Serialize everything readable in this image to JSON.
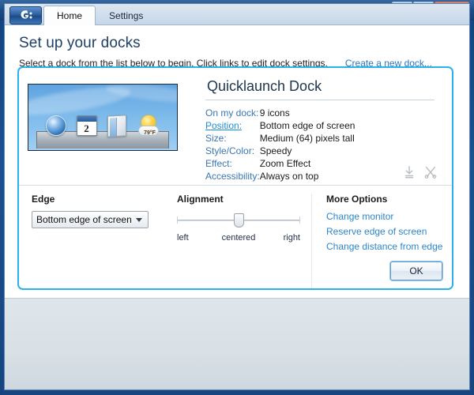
{
  "window": {
    "controls": {
      "minimize": "minimize-button",
      "maximize": "maximize-button",
      "close": "✕"
    }
  },
  "tabs": [
    {
      "label": "Home",
      "active": true
    },
    {
      "label": "Settings",
      "active": false
    }
  ],
  "header": {
    "title": "Set up your docks",
    "subtitle": "Select a dock from the list below to begin. Click links to edit dock settings.",
    "create_link": "Create a new dock..."
  },
  "dock": {
    "name": "Quicklaunch Dock",
    "preview": {
      "icons": [
        "windows-orb",
        "calendar",
        "document",
        "weather"
      ],
      "calendar_day": "2",
      "weather_temp": "79°F"
    },
    "specs": [
      {
        "label": "On my dock:",
        "value": "9 icons",
        "is_link": false
      },
      {
        "label": "Position:",
        "value": "Bottom edge of screen",
        "is_link": true
      },
      {
        "label": "Size:",
        "value": "Medium (64) pixels tall",
        "is_link": false
      },
      {
        "label": "Style/Color:",
        "value": "Speedy",
        "is_link": false
      },
      {
        "label": "Effect:",
        "value": "Zoom Effect",
        "is_link": false
      },
      {
        "label": "Accessibility:",
        "value": "Always on top",
        "is_link": false
      }
    ],
    "panel_icons": [
      "download-icon",
      "scissors-icon"
    ]
  },
  "edge": {
    "title": "Edge",
    "selected": "Bottom edge of screen"
  },
  "alignment": {
    "title": "Alignment",
    "value": "centered",
    "labels": {
      "left": "left",
      "center": "centered",
      "right": "right"
    }
  },
  "more_options": {
    "title": "More Options",
    "links": [
      "Change monitor",
      "Reserve edge of screen",
      "Change distance from edge"
    ]
  },
  "buttons": {
    "ok": "OK"
  },
  "colors": {
    "accent": "#2bb1ec",
    "link": "#2e86c8",
    "label": "#3a77b5",
    "heading": "#1d3f66",
    "titlebar": "#1d4d89",
    "close": "#c2452b"
  }
}
